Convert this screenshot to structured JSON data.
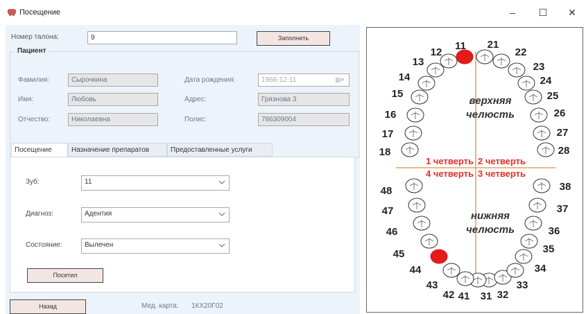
{
  "window": {
    "title": "Посещение",
    "minimize_glyph": "–",
    "maximize_glyph": "☐",
    "close_glyph": "✕"
  },
  "ticket": {
    "label": "Номер талона:",
    "value": "9",
    "fill_button": "Заполнить"
  },
  "patient": {
    "group_title": "Пациент",
    "surname_label": "Фамилия:",
    "surname_value": "Сырочкина",
    "name_label": "Имя:",
    "name_value": "Любовь",
    "patronymic_label": "Отчество:",
    "patronymic_value": "Николаевна",
    "dob_label": "Дата рождения:",
    "dob_value": "1968-12-11",
    "address_label": "Адрес:",
    "address_value": "Грязнова 3",
    "policy_label": "Полис:",
    "policy_value": "786309004"
  },
  "tabs": [
    {
      "label": "Посещение",
      "active": true
    },
    {
      "label": "Назначение препаратов",
      "active": false
    },
    {
      "label": "Предоставленные услуги",
      "active": false
    }
  ],
  "visit": {
    "tooth_label": "Зуб:",
    "tooth_value": "11",
    "diagnosis_label": "Диагноз:",
    "diagnosis_value": "Адентия",
    "state_label": "Состояние:",
    "state_value": "Вылечен",
    "visit_button": "Посетил"
  },
  "footer": {
    "back_button": "Назад",
    "card_label": "Мед. карта:",
    "card_value": "1КХ20Г02"
  },
  "dental_chart": {
    "upper_jaw_line1": "верхняя",
    "upper_jaw_line2": "челюсть",
    "lower_jaw_line1": "нижняя",
    "lower_jaw_line2": "челюсть",
    "q1": "1 четверть",
    "q2": "2 четверть",
    "q3": "3 четверть",
    "q4": "4 четверть",
    "highlight_color": "#e21b1b",
    "divider_color": "#e8a060",
    "quadrant_color": "#e0302a",
    "teeth": [
      "11",
      "12",
      "13",
      "14",
      "15",
      "16",
      "17",
      "18",
      "21",
      "22",
      "23",
      "24",
      "25",
      "26",
      "27",
      "28",
      "31",
      "32",
      "33",
      "34",
      "35",
      "36",
      "37",
      "38",
      "41",
      "42",
      "43",
      "44",
      "45",
      "46",
      "47",
      "48"
    ],
    "selected_teeth": [
      "11",
      "44"
    ]
  }
}
